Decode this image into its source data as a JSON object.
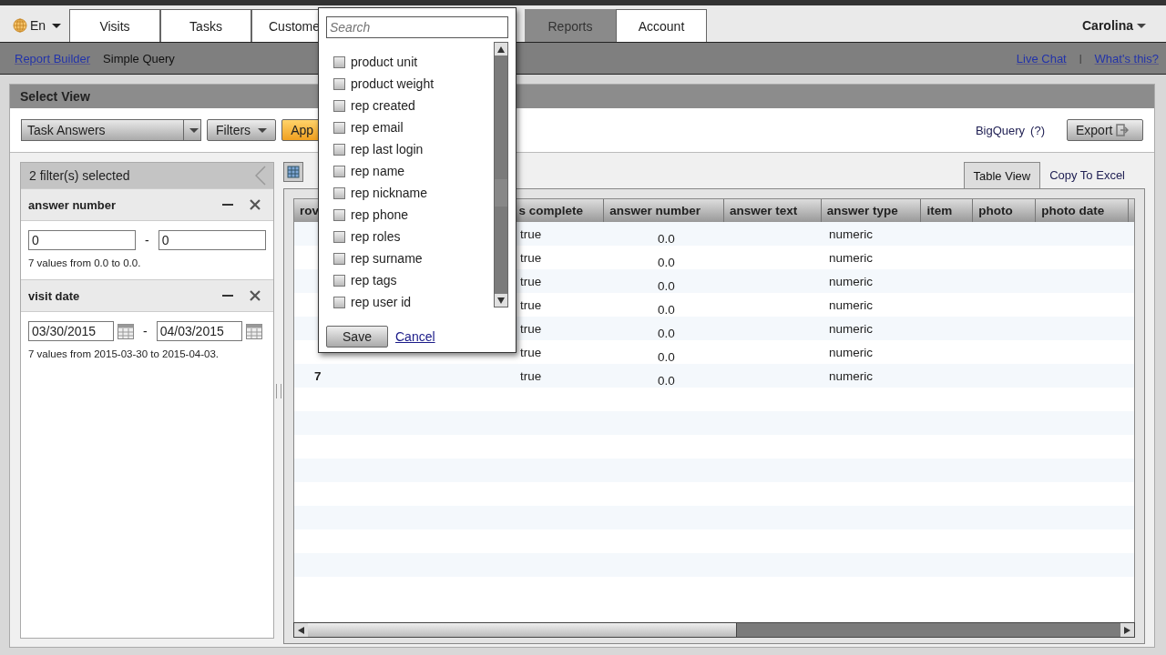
{
  "language": {
    "label": "En"
  },
  "tabs": [
    {
      "label": "Visits",
      "selected": false
    },
    {
      "label": "Tasks",
      "selected": false
    },
    {
      "label": "Custome",
      "selected": false
    },
    {
      "label": "Reports",
      "selected": true
    },
    {
      "label": "Account",
      "selected": false
    }
  ],
  "user": {
    "name": "Carolina"
  },
  "subnav": {
    "links": [
      {
        "label": "Report Builder",
        "kind": "link"
      },
      {
        "label": "Simple Query",
        "kind": "text"
      }
    ],
    "help_links": [
      "Live Chat",
      "What's this?"
    ],
    "separator": "|"
  },
  "panel": {
    "title": "Select View",
    "view_select": "Task Answers",
    "filters_button": "Filters",
    "apply_button": "App",
    "bigquery": "BigQuery",
    "bigquery_help": "(?)",
    "export_button": "Export"
  },
  "filters": {
    "summary": "2 filter(s) selected",
    "separator": "-",
    "items": [
      {
        "name": "answer number",
        "kind": "number",
        "from": "0",
        "to": "0",
        "note": "7 values from 0.0 to 0.0."
      },
      {
        "name": "visit date",
        "kind": "date",
        "from": "03/30/2015",
        "to": "04/03/2015",
        "note": "7 values from 2015-03-30 to 2015-04-03."
      }
    ]
  },
  "view_tabs": [
    {
      "label": "Table View",
      "selected": true
    },
    {
      "label": "Copy To Excel",
      "selected": false
    }
  ],
  "table": {
    "columns": [
      "rov",
      "s complete",
      "answer number",
      "answer text",
      "answer type",
      "item",
      "photo",
      "photo date"
    ],
    "rows": [
      {
        "complete": "true",
        "answer_number": "0.0",
        "answer_type": "numeric"
      },
      {
        "complete": "true",
        "answer_number": "0.0",
        "answer_type": "numeric"
      },
      {
        "complete": "true",
        "answer_number": "0.0",
        "answer_type": "numeric"
      },
      {
        "complete": "true",
        "answer_number": "0.0",
        "answer_type": "numeric"
      },
      {
        "complete": "true",
        "answer_number": "0.0",
        "answer_type": "numeric"
      },
      {
        "complete": "true",
        "answer_number": "0.0",
        "answer_type": "numeric"
      },
      {
        "row_number": "7",
        "complete": "true",
        "answer_number": "0.0",
        "answer_type": "numeric"
      }
    ]
  },
  "column_picker": {
    "search_placeholder": "Search",
    "options": [
      {
        "label": "product unit",
        "checked": false
      },
      {
        "label": "product weight",
        "checked": false
      },
      {
        "label": "rep created",
        "checked": false
      },
      {
        "label": "rep email",
        "checked": false
      },
      {
        "label": "rep last login",
        "checked": false
      },
      {
        "label": "rep name",
        "checked": false
      },
      {
        "label": "rep nickname",
        "checked": false
      },
      {
        "label": "rep phone",
        "checked": false
      },
      {
        "label": "rep roles",
        "checked": false
      },
      {
        "label": "rep surname",
        "checked": false
      },
      {
        "label": "rep tags",
        "checked": false
      },
      {
        "label": "rep user id",
        "checked": false
      }
    ],
    "save_button": "Save",
    "cancel_link": "Cancel"
  }
}
